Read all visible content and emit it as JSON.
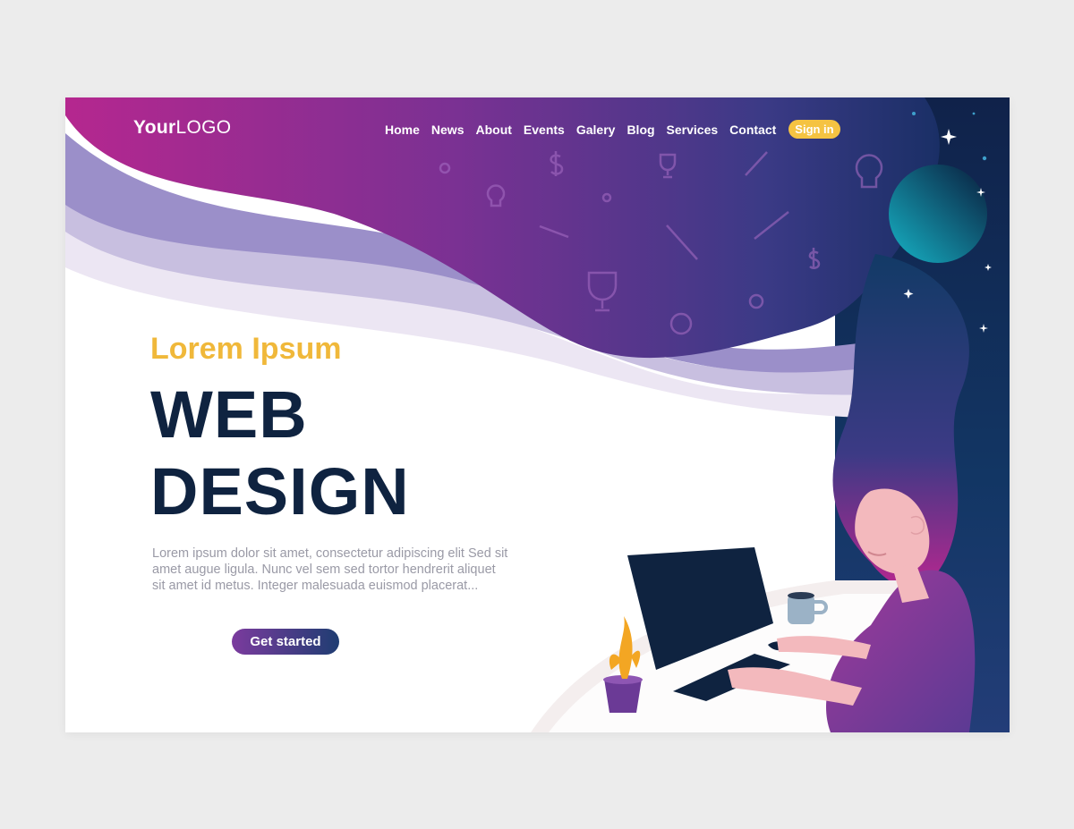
{
  "logo": {
    "bold": "Your",
    "light": "LOGO"
  },
  "nav": {
    "items": [
      "Home",
      "News",
      "About",
      "Events",
      "Galery",
      "Blog",
      "Services",
      "Contact"
    ],
    "signin": "Sign in"
  },
  "hero": {
    "kicker": "Lorem Ipsum",
    "title_line1": "WEB",
    "title_line2": "DESIGN",
    "paragraph": "Lorem ipsum dolor sit amet, consectetur adipiscing elit Sed sit amet augue ligula. Nunc vel sem sed tortor hendrerit aliquet sit amet id metus. Integer malesuada euismod placerat...",
    "cta": "Get started"
  },
  "colors": {
    "page_bg": "#ececec",
    "magenta": "#b5278f",
    "purple": "#6b3a96",
    "navy": "#0f2340",
    "accent_yellow": "#f0b83a",
    "body_text": "#9a9aa6"
  },
  "icons": [
    "gear-icon",
    "dollar-icon",
    "trophy-icon",
    "pencil-icon",
    "lightbulb-icon",
    "wrench-icon",
    "star-icon",
    "planet-icon"
  ]
}
